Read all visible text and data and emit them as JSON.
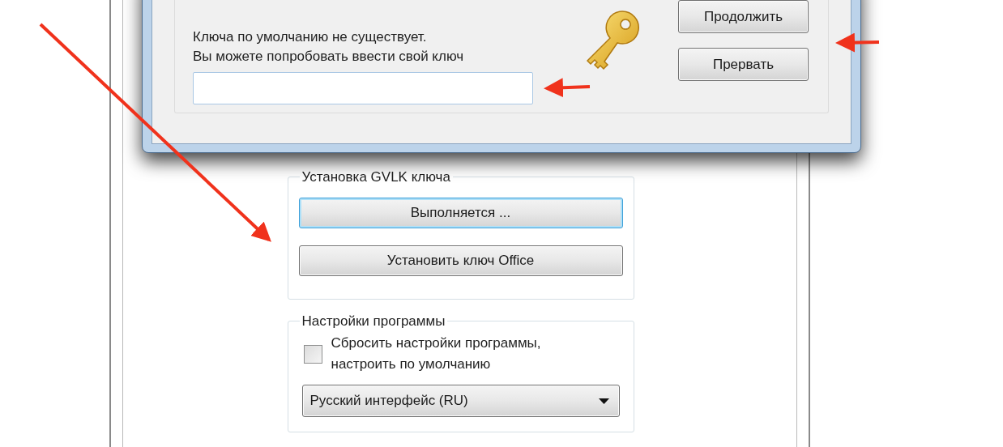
{
  "dialog": {
    "message": "Ключа по умолчанию не существует.\nВы можете попробовать ввести свой ключ",
    "buttons": [
      {
        "label": "Продолжить"
      },
      {
        "label": "Прервать"
      }
    ]
  },
  "gvlk_group": {
    "title": "Установка GVLK ключа",
    "buttons": [
      {
        "label": "Выполняется ...",
        "focused": true
      },
      {
        "label": "Установить ключ Office",
        "focused": false
      }
    ]
  },
  "settings_group": {
    "title": "Настройки программы",
    "reset_checkbox": {
      "label": "Сбросить настройки программы, настроить по умолчанию",
      "checked": false
    },
    "language_select": {
      "value": "Русский интерфейс (RU)"
    }
  }
}
